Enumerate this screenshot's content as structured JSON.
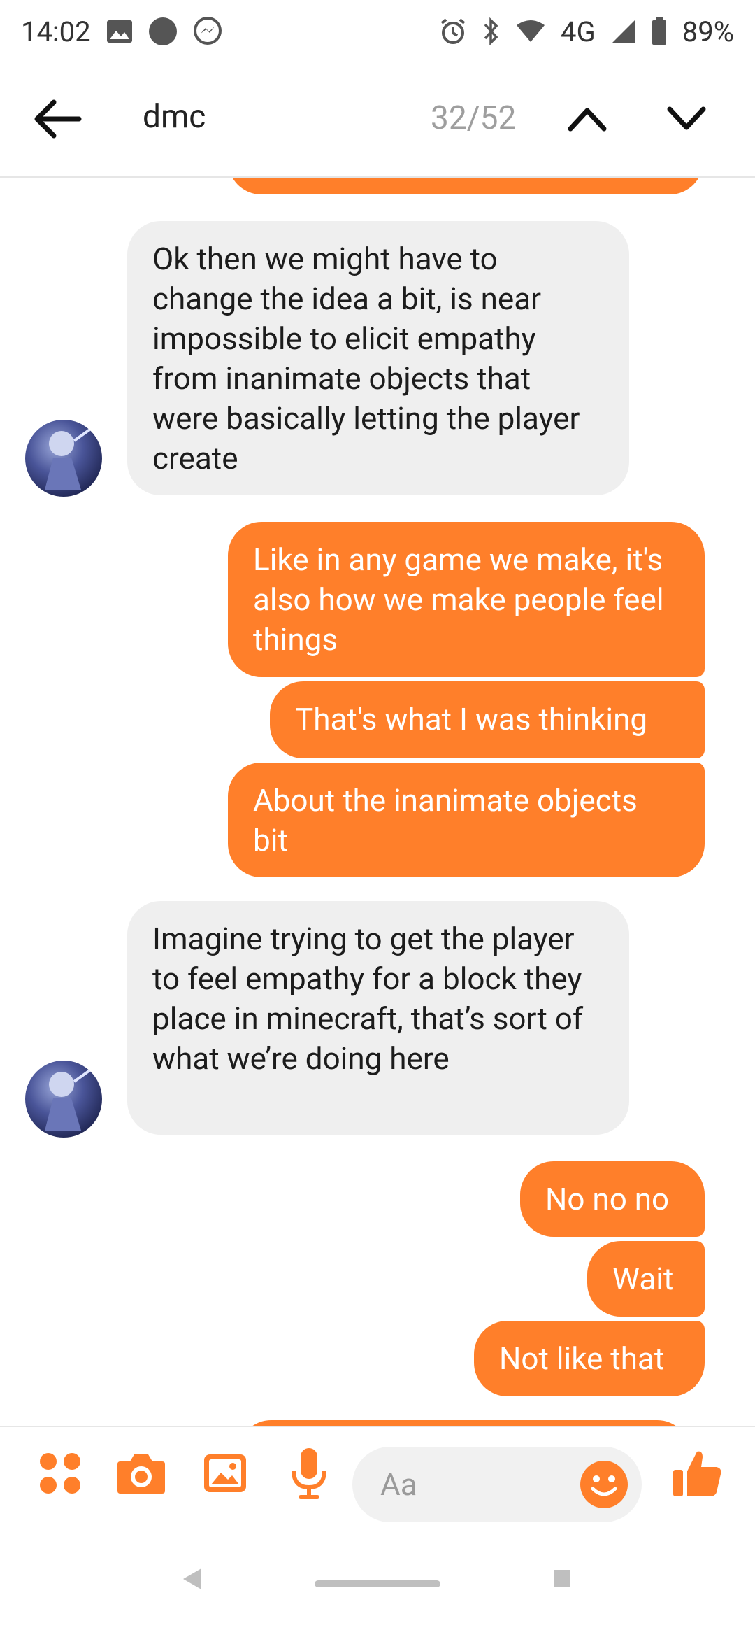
{
  "status_bar": {
    "time": "14:02",
    "network": "4G",
    "battery": "89%"
  },
  "search": {
    "query": "dmc",
    "counter": "32/52"
  },
  "messages": [
    {
      "side": "incoming",
      "text": "Ok then we might have to change the idea a bit, is near impossible to elicit empathy from inanimate objects that were basically letting the player create"
    },
    {
      "side": "outgoing",
      "text": "Like in any game we make, it's also how we make people feel things"
    },
    {
      "side": "outgoing",
      "text": "That's what I was thinking"
    },
    {
      "side": "outgoing",
      "text": "About the inanimate objects bit"
    },
    {
      "side": "incoming",
      "text": "Imagine trying to get the player to feel empathy for a block they place in minecraft, that’s sort of what we’re doing here"
    },
    {
      "side": "outgoing",
      "text": "No no no"
    },
    {
      "side": "outgoing",
      "text": "Wait"
    },
    {
      "side": "outgoing",
      "text": "Not like that"
    }
  ],
  "composer": {
    "placeholder": "Aa"
  },
  "colors": {
    "accent": "#ff7f2a",
    "incoming_bubble": "#efefef"
  },
  "icons": [
    "gallery-icon",
    "dot-icon",
    "messenger-icon",
    "alarm-icon",
    "bluetooth-icon",
    "wifi-icon",
    "signal-icon",
    "battery-icon",
    "back-arrow-icon",
    "chevron-up-icon",
    "chevron-down-icon",
    "apps-icon",
    "camera-icon",
    "image-icon",
    "microphone-icon",
    "emoji-icon",
    "thumbs-up-icon"
  ]
}
